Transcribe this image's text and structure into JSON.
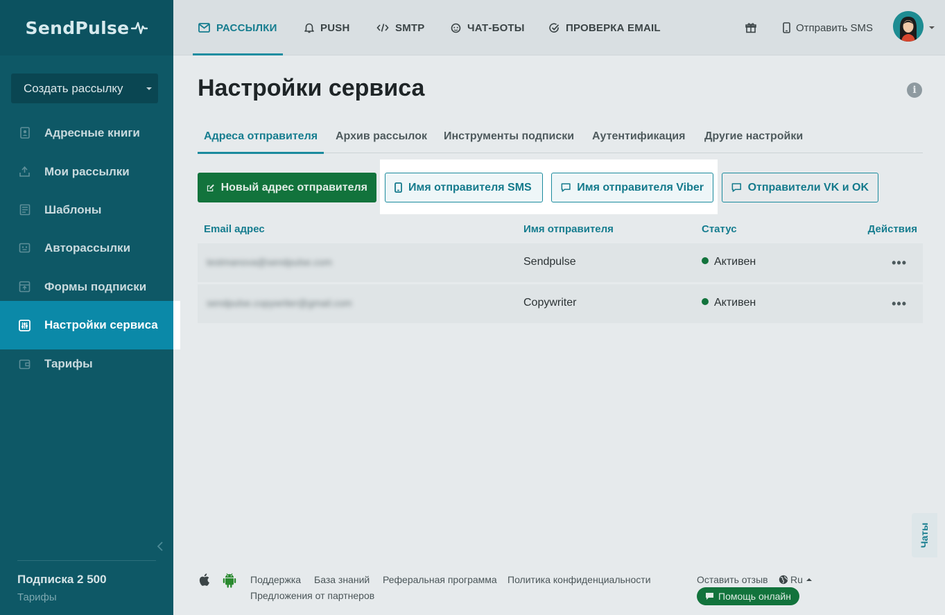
{
  "brand": {
    "name": "SendPulse"
  },
  "sidebar": {
    "create_button": "Создать рассылку",
    "items": [
      {
        "label": "Адресные книги",
        "icon": "address-book-icon"
      },
      {
        "label": "Мои рассылки",
        "icon": "campaigns-icon"
      },
      {
        "label": "Шаблоны",
        "icon": "templates-icon"
      },
      {
        "label": "Авторассылки",
        "icon": "automation-icon"
      },
      {
        "label": "Формы подписки",
        "icon": "subscription-form-icon"
      },
      {
        "label": "Настройки сервиса",
        "icon": "settings-sliders-icon",
        "active": true
      },
      {
        "label": "Тарифы",
        "icon": "wallet-icon"
      }
    ],
    "plan_title": "Подписка 2 500",
    "plan_link": "Тарифы"
  },
  "topnav": {
    "items": [
      {
        "label": "РАССЫЛКИ",
        "icon": "mail-icon",
        "active": true
      },
      {
        "label": "PUSH",
        "icon": "bell-icon"
      },
      {
        "label": "SMTP",
        "icon": "code-icon"
      },
      {
        "label": "ЧАТ-БОТЫ",
        "icon": "chatbot-icon"
      },
      {
        "label": "ПРОВЕРКА EMAIL",
        "icon": "check-circle-icon"
      }
    ],
    "gift_icon": "gift-icon",
    "send_sms": "Отправить SMS"
  },
  "main": {
    "title": "Настройки сервиса",
    "tabs": [
      {
        "label": "Адреса отправителя",
        "active": true
      },
      {
        "label": "Архив рассылок"
      },
      {
        "label": "Инструменты подписки"
      },
      {
        "label": "Аутентификация"
      },
      {
        "label": "Другие настройки"
      }
    ],
    "buttons": {
      "new_sender": "Новый адрес отправителя",
      "sms_sender": "Имя отправителя SMS",
      "viber_sender": "Имя отправителя Viber",
      "vk_ok_senders": "Отправители VK и OK"
    },
    "table": {
      "headers": {
        "email": "Email адрес",
        "name": "Имя отправителя",
        "status": "Статус",
        "actions": "Действия"
      },
      "rows": [
        {
          "email": "testmanova@sendpulse.com",
          "name": "Sendpulse",
          "status": "Активен"
        },
        {
          "email": "sendpulse.copywriter@gmail.com",
          "name": "Copywriter",
          "status": "Активен"
        }
      ]
    }
  },
  "footer": {
    "links": [
      "Поддержка",
      "База знаний",
      "Реферальная программа",
      "Политика конфиденциальности"
    ],
    "partners": "Предложения от партнеров",
    "feedback": "Оставить отзыв",
    "language": "Ru",
    "help": "Помощь онлайн",
    "chats": "Чаты"
  },
  "colors": {
    "sidebar": "#0e5866",
    "active": "#0b89a8",
    "accent": "#167d8f",
    "primary": "#12733c"
  }
}
